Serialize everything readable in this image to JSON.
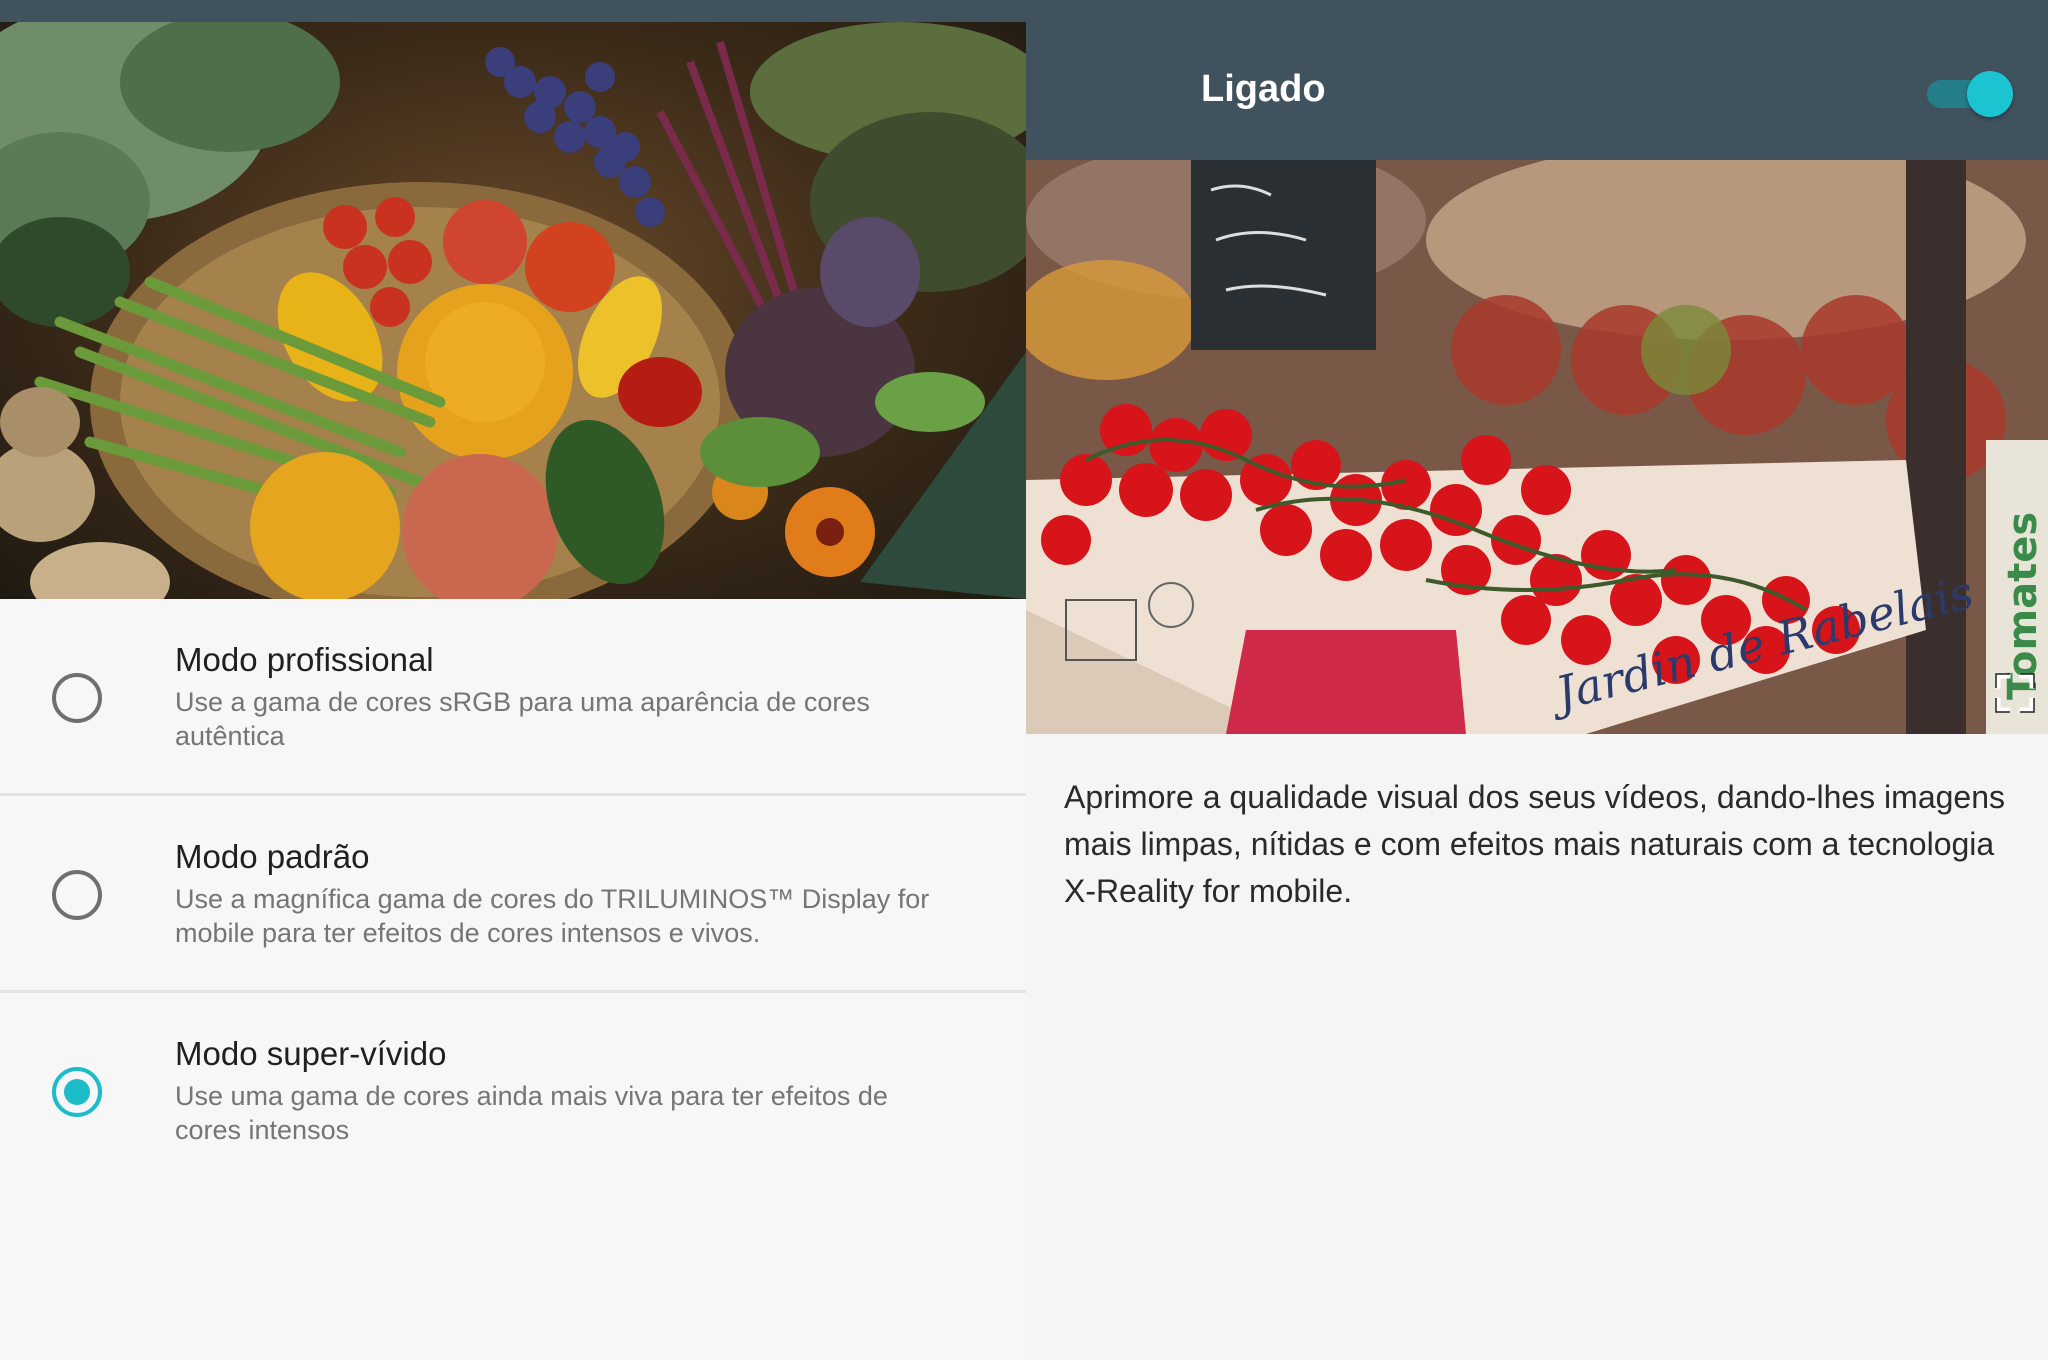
{
  "colors": {
    "header_bg": "#41525f",
    "accent": "#1cbcc9",
    "panel_bg": "#f5f5f5"
  },
  "left_panel": {
    "image_alt": "vegetables",
    "options": [
      {
        "title": "Modo profissional",
        "description": "Use a gama de cores sRGB para uma aparência de cores autêntica",
        "selected": false
      },
      {
        "title": "Modo padrão",
        "description": "Use a magnífica gama de cores do TRILUMINOS™ Display for mobile para ter efeitos de cores intensos e vivos.",
        "selected": false
      },
      {
        "title": "Modo super-vívido",
        "description": "Use uma gama de cores ainda mais viva para ter efeitos de cores intensos",
        "selected": true
      }
    ]
  },
  "right_panel": {
    "header_title": "Ligado",
    "toggle_state": "on",
    "image_sign_text": "Jardin de Rabelais",
    "image_side_text": "Tomates",
    "expand_icon": "fullscreen-icon",
    "description": "Aprimore a qualidade visual dos seus vídeos, dando-lhes imagens mais limpas, nítidas e com efeitos mais naturais com a tecnologia X-Reality for mobile."
  }
}
